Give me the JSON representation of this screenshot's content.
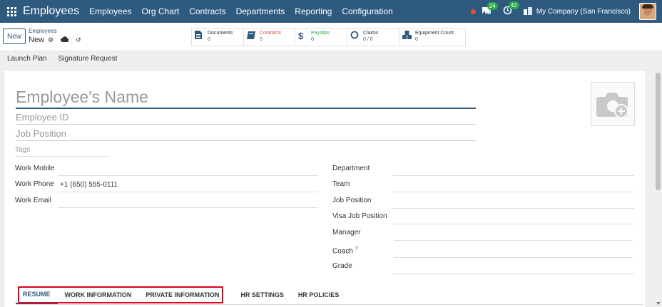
{
  "navbar": {
    "app_title": "Employees",
    "menu": [
      "Employees",
      "Org Chart",
      "Contracts",
      "Departments",
      "Reporting",
      "Configuration"
    ],
    "messages_badge": "24",
    "activities_badge": "42",
    "company": "My Company (San Francisco)"
  },
  "control": {
    "new_label": "New",
    "breadcrumb_parent": "Employees",
    "breadcrumb_current": "New",
    "stats": [
      {
        "icon": "document-icon",
        "glyph": "▤",
        "label": "Documents",
        "value": "0",
        "color": "#333333"
      },
      {
        "icon": "contract-book-icon",
        "glyph": "📘",
        "label": "Contracts",
        "value": "0",
        "color": "#d0493a"
      },
      {
        "icon": "dollar-icon",
        "glyph": "$",
        "label": "Payslips",
        "value": "0",
        "color": "#28a745"
      },
      {
        "icon": "circle-icon",
        "glyph": "○",
        "label": "Claims",
        "value": "0 / 0",
        "color": "#333333"
      },
      {
        "icon": "cubes-icon",
        "glyph": "⛃",
        "label": "Equipment Count",
        "value": "0",
        "color": "#333333"
      }
    ]
  },
  "statusbar": {
    "launch_plan": "Launch Plan",
    "signature_request": "Signature Request"
  },
  "form": {
    "name_placeholder": "Employee's Name",
    "employee_id_placeholder": "Employee ID",
    "job_position_placeholder": "Job Position",
    "tags_placeholder": "Tags",
    "left_fields": [
      {
        "label": "Work Mobile",
        "value": ""
      },
      {
        "label": "Work Phone",
        "value": "+1 (650) 555-0111"
      },
      {
        "label": "Work Email",
        "value": ""
      }
    ],
    "right_fields": [
      {
        "label": "Department",
        "value": ""
      },
      {
        "label": "Team",
        "value": ""
      },
      {
        "label": "Job Position",
        "value": ""
      },
      {
        "label": "Visa Job Position",
        "value": ""
      },
      {
        "label": "Manager",
        "value": ""
      },
      {
        "label": "Coach",
        "value": "",
        "help": "?"
      },
      {
        "label": "Grade",
        "value": ""
      }
    ],
    "tabs": [
      "RESUME",
      "WORK INFORMATION",
      "PRIVATE INFORMATION",
      "HR SETTINGS",
      "HR POLICIES"
    ],
    "active_tab": "RESUME"
  },
  "colors": {
    "navbar": "#2f5a80",
    "highlight": "#e0001b",
    "badge": "#28a745"
  }
}
